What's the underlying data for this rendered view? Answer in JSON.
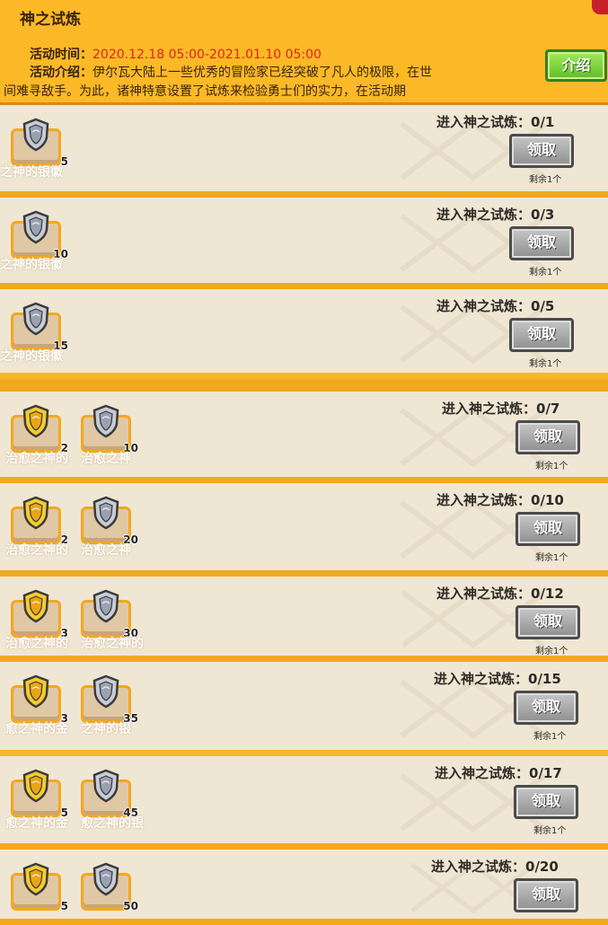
{
  "header": {
    "title": "神之试炼",
    "time_label": "活动时间：",
    "time_value": "2020.12.18 05:00-2021.01.10 05:00",
    "intro_label": "活动介绍：",
    "intro_line1": "伊尔瓦大陆上一些优秀的冒险家已经突破了凡人的极限，在世",
    "intro_line2": "间难寻敌手。为此，诸神特意设置了试炼来检验勇士们的实力，在活动期",
    "intro_button": "介绍"
  },
  "colors": {
    "accent": "#f3a81e",
    "time_red": "#e1231a",
    "button_green": "#6cc733",
    "button_gray": "#9a9a9a"
  },
  "rows": [
    {
      "label": "进入神之试炼：0/1",
      "button": "领取",
      "remain": "剩余1个",
      "items": [
        {
          "icon": "silver-shield-icon",
          "qty": "5",
          "name": "之神的银徽"
        }
      ]
    },
    {
      "label": "进入神之试炼：0/3",
      "button": "领取",
      "remain": "剩余1个",
      "items": [
        {
          "icon": "silver-shield-icon",
          "qty": "10",
          "name": "之神的银徽"
        }
      ]
    },
    {
      "label": "进入神之试炼：0/5",
      "button": "领取",
      "remain": "剩余1个",
      "items": [
        {
          "icon": "silver-shield-icon",
          "qty": "15",
          "name": "之神的银徽"
        }
      ]
    },
    {
      "label": "进入神之试炼：0/7",
      "button": "领取",
      "remain": "剩余1个",
      "items": [
        {
          "icon": "gold-shield-icon",
          "qty": "2",
          "name": "治愈之神的"
        },
        {
          "icon": "silver-shield-icon",
          "qty": "10",
          "name": "治愈之神"
        }
      ]
    },
    {
      "label": "进入神之试炼：0/10",
      "button": "领取",
      "remain": "剩余1个",
      "items": [
        {
          "icon": "gold-shield-icon",
          "qty": "2",
          "name": "治愈之神的"
        },
        {
          "icon": "silver-shield-icon",
          "qty": "20",
          "name": "治愈之神"
        }
      ]
    },
    {
      "label": "进入神之试炼：0/12",
      "button": "领取",
      "remain": "剩余1个",
      "items": [
        {
          "icon": "gold-shield-icon",
          "qty": "3",
          "name": "治愈之神的"
        },
        {
          "icon": "silver-shield-icon",
          "qty": "30",
          "name": "治愈之神的"
        }
      ]
    },
    {
      "label": "进入神之试炼：0/15",
      "button": "领取",
      "remain": "剩余1个",
      "items": [
        {
          "icon": "gold-shield-icon",
          "qty": "3",
          "name": "愈之神的金"
        },
        {
          "icon": "silver-shield-icon",
          "qty": "35",
          "name": "之神的银"
        }
      ]
    },
    {
      "label": "进入神之试炼：0/17",
      "button": "领取",
      "remain": "剩余1个",
      "items": [
        {
          "icon": "gold-shield-icon",
          "qty": "5",
          "name": "愈之神的金"
        },
        {
          "icon": "silver-shield-icon",
          "qty": "45",
          "name": "愈之神的银"
        }
      ]
    },
    {
      "label": "进入神之试炼：0/20",
      "button": "领取",
      "remain": "",
      "items": [
        {
          "icon": "gold-shield-icon",
          "qty": "5",
          "name": ""
        },
        {
          "icon": "silver-shield-icon",
          "qty": "50",
          "name": ""
        }
      ]
    }
  ]
}
